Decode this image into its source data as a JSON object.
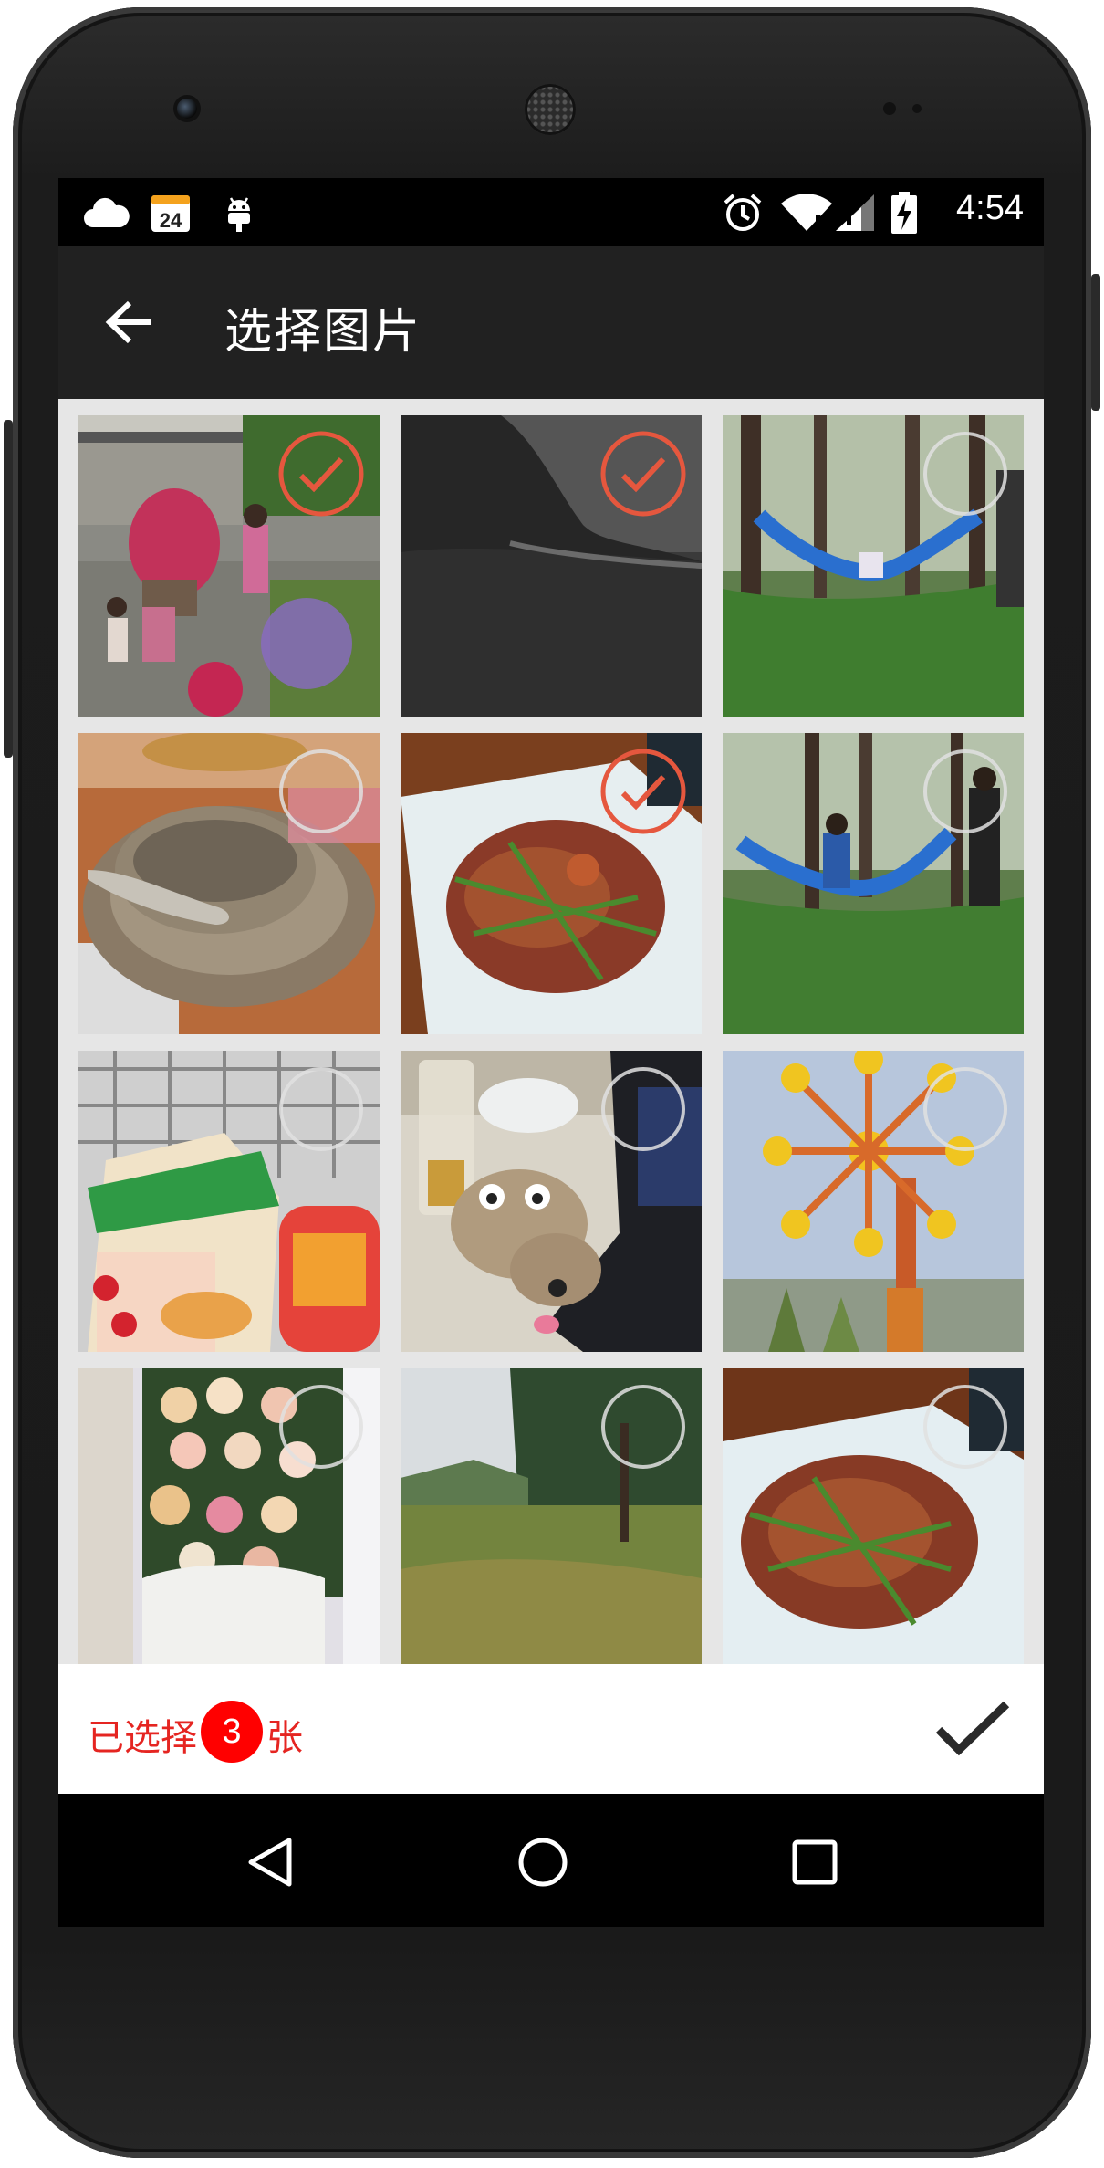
{
  "status_bar": {
    "time": "4:54",
    "calendar_day": "24",
    "icons": [
      "cloud-icon",
      "calendar-icon",
      "android-debug-icon",
      "alarm-icon",
      "wifi-icon",
      "signal-icon",
      "battery-charging-icon"
    ]
  },
  "app_bar": {
    "title": "选择图片",
    "back_icon": "arrow-back-icon"
  },
  "photos": [
    {
      "scene": "family-garden",
      "selected": true
    },
    {
      "scene": "grey-texture",
      "selected": true
    },
    {
      "scene": "hammock-forest",
      "selected": false
    },
    {
      "scene": "ceramic-bowl",
      "selected": false
    },
    {
      "scene": "meat-dish",
      "selected": true
    },
    {
      "scene": "hammock-people",
      "selected": false
    },
    {
      "scene": "snack-cart",
      "selected": false
    },
    {
      "scene": "plush-toy-desk",
      "selected": false
    },
    {
      "scene": "amusement-ride",
      "selected": false
    },
    {
      "scene": "rose-bouquet",
      "selected": false
    },
    {
      "scene": "park-lawn",
      "selected": false
    },
    {
      "scene": "meat-dish-2",
      "selected": false
    }
  ],
  "selection_bar": {
    "prefix": "已选择",
    "count": "3",
    "suffix": "张",
    "confirm_icon": "checkmark-icon"
  },
  "colors": {
    "accent_red": "#e5573e",
    "count_badge": "#ff0000",
    "label_red": "#e52521",
    "app_bar": "#212121"
  },
  "nav_bar": [
    "back-triangle-icon",
    "home-circle-icon",
    "recents-square-icon"
  ]
}
